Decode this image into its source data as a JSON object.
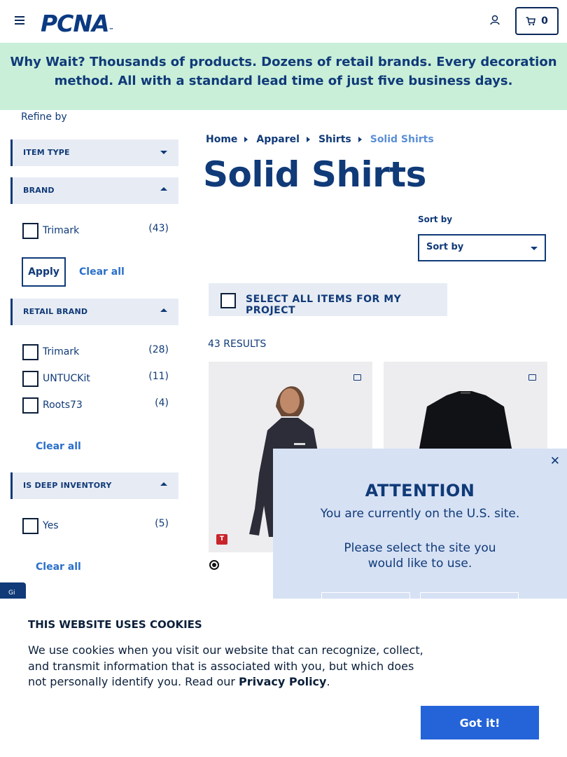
{
  "header": {
    "logo": "PCNA",
    "logo_mark": "™",
    "cart_count": "0"
  },
  "banner": {
    "lead": "Why Wait?",
    "text": " Thousands of products. Dozens of retail brands. Every decoration method. All with a standard lead time of just five business days."
  },
  "sidebar": {
    "refine_label": "Refine by",
    "facets": {
      "item_type": {
        "label": "ITEM TYPE"
      },
      "brand": {
        "label": "BRAND",
        "options": [
          {
            "label": "Trimark",
            "count": "(43)"
          }
        ],
        "apply_label": "Apply",
        "clear_label": "Clear all"
      },
      "retail_brand": {
        "label": "RETAIL BRAND",
        "options": [
          {
            "label": "Trimark",
            "count": "(28)"
          },
          {
            "label": "UNTUCKit",
            "count": "(11)"
          },
          {
            "label": "Roots73",
            "count": "(4)"
          }
        ],
        "clear_label": "Clear all"
      },
      "deep_inventory": {
        "label": "IS DEEP INVENTORY",
        "options": [
          {
            "label": "Yes",
            "count": "(5)"
          }
        ],
        "clear_label": "Clear all"
      }
    }
  },
  "breadcrumb": [
    "Home",
    "Apparel",
    "Shirts",
    "Solid Shirts"
  ],
  "page_title": "Solid Shirts",
  "sort": {
    "label": "Sort by",
    "value": "Sort by"
  },
  "select_all_label": "SELECT ALL ITEMS FOR MY PROJECT",
  "results_label": "43 RESULTS",
  "product_cards": [
    {
      "badge": "T"
    },
    {
      "badge": ""
    }
  ],
  "modal": {
    "title": "ATTENTION",
    "line1": "You are currently on the U.S. site.",
    "line2": "Please select the site you",
    "line3": "would like to use.",
    "close": "✕"
  },
  "feedback_tab": "Gi",
  "cookie": {
    "title": "THIS WEBSITE USES COOKIES",
    "text": "We use cookies when you visit our website that can recognize, collect, and transmit information that is associated with you, but which does not personally identify you. Read our ",
    "link": "Privacy Policy",
    "suffix": ".",
    "button": "Got it!"
  },
  "colors": {
    "navy": "#103a78",
    "banner_bg": "#c9efd9",
    "facet_bg": "#e7ecf4",
    "modal_bg": "#d6e1f4",
    "cta_blue": "#2464d8",
    "badge_red": "#c8252c"
  }
}
